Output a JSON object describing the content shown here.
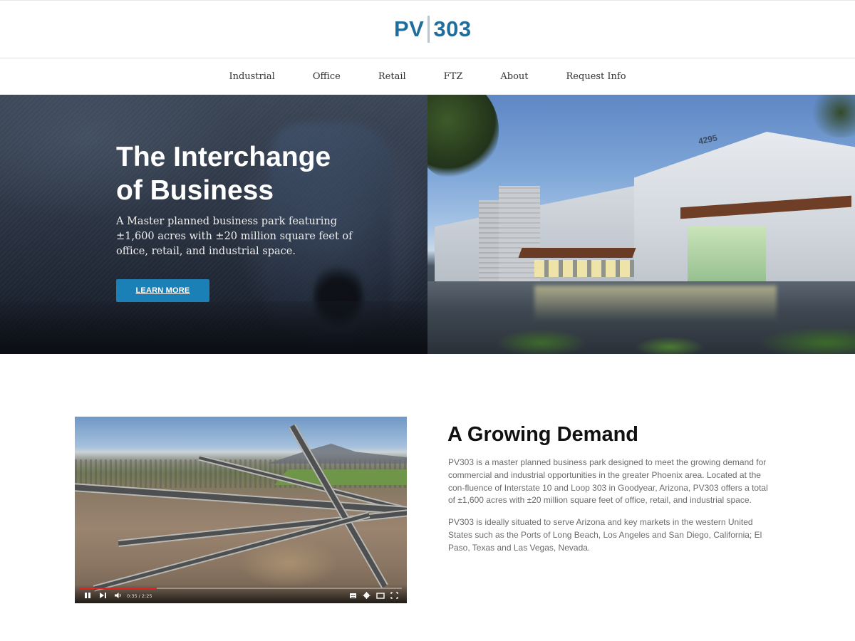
{
  "header": {
    "logo_left": "PV",
    "logo_right": "303",
    "brand_color": "#1f6e9c"
  },
  "nav": {
    "items": [
      "Industrial",
      "Office",
      "Retail",
      "FTZ",
      "About",
      "Request Info"
    ]
  },
  "hero": {
    "title_line1": "The Interchange",
    "title_line2": "of Business",
    "subtitle": "A Master planned business park featuring ±1,600 acres with ±20 million square feet of office, retail, and industrial space.",
    "button_label": "LEARN MORE",
    "button_color": "#1b80b6",
    "building_number": "4295"
  },
  "video": {
    "time": "0:35 / 2:25",
    "progress_fraction": 0.24,
    "icons": [
      "pause-icon",
      "next-icon",
      "volume-icon",
      "captions-icon",
      "settings-icon",
      "theater-icon",
      "fullscreen-icon"
    ]
  },
  "section": {
    "title": "A Growing Demand",
    "paragraph1": "PV303 is a master planned business park designed to meet the growing demand for commercial and industrial opportunities in the greater Phoenix area. Located at the con-fluence of Interstate 10 and Loop 303 in Goodyear, Arizona, PV303 offers a total of ±1,600 acres with ±20 million square feet of office, retail, and industrial space.",
    "paragraph2": "PV303 is ideally situated to serve Arizona and key markets in the western United States such as the Ports of Long Beach, Los Angeles and San Diego, California; El Paso, Texas and Las Vegas, Nevada."
  }
}
